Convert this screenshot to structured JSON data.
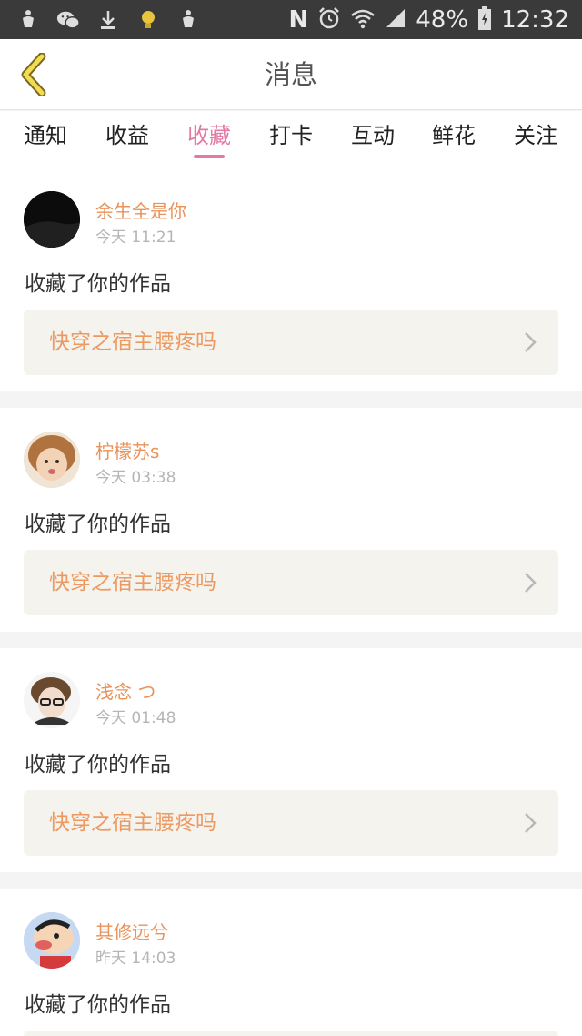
{
  "status_bar": {
    "battery": "48%",
    "time": "12:32",
    "network_letter": "N"
  },
  "header": {
    "title": "消息",
    "back_icon": "chevron-left-icon"
  },
  "tabs": [
    "通知",
    "收益",
    "收藏",
    "打卡",
    "互动",
    "鲜花",
    "关注"
  ],
  "active_tab": "收藏",
  "colors": {
    "accent_pink": "#e37aa4",
    "name_orange": "#e9925a",
    "link_orange": "#ec9a62",
    "link_bg": "#f4f3ee"
  },
  "messages": [
    {
      "user": "余生全是你",
      "time": "今天 11:21",
      "action": "收藏了你的作品",
      "work": "快穿之宿主腰疼吗"
    },
    {
      "user": "柠檬苏s",
      "time": "今天 03:38",
      "action": "收藏了你的作品",
      "work": "快穿之宿主腰疼吗"
    },
    {
      "user": "浅念 つ",
      "time": "今天 01:48",
      "action": "收藏了你的作品",
      "work": "快穿之宿主腰疼吗"
    },
    {
      "user": "其修远兮",
      "time": "昨天 14:03",
      "action": "收藏了你的作品",
      "work": ""
    }
  ]
}
